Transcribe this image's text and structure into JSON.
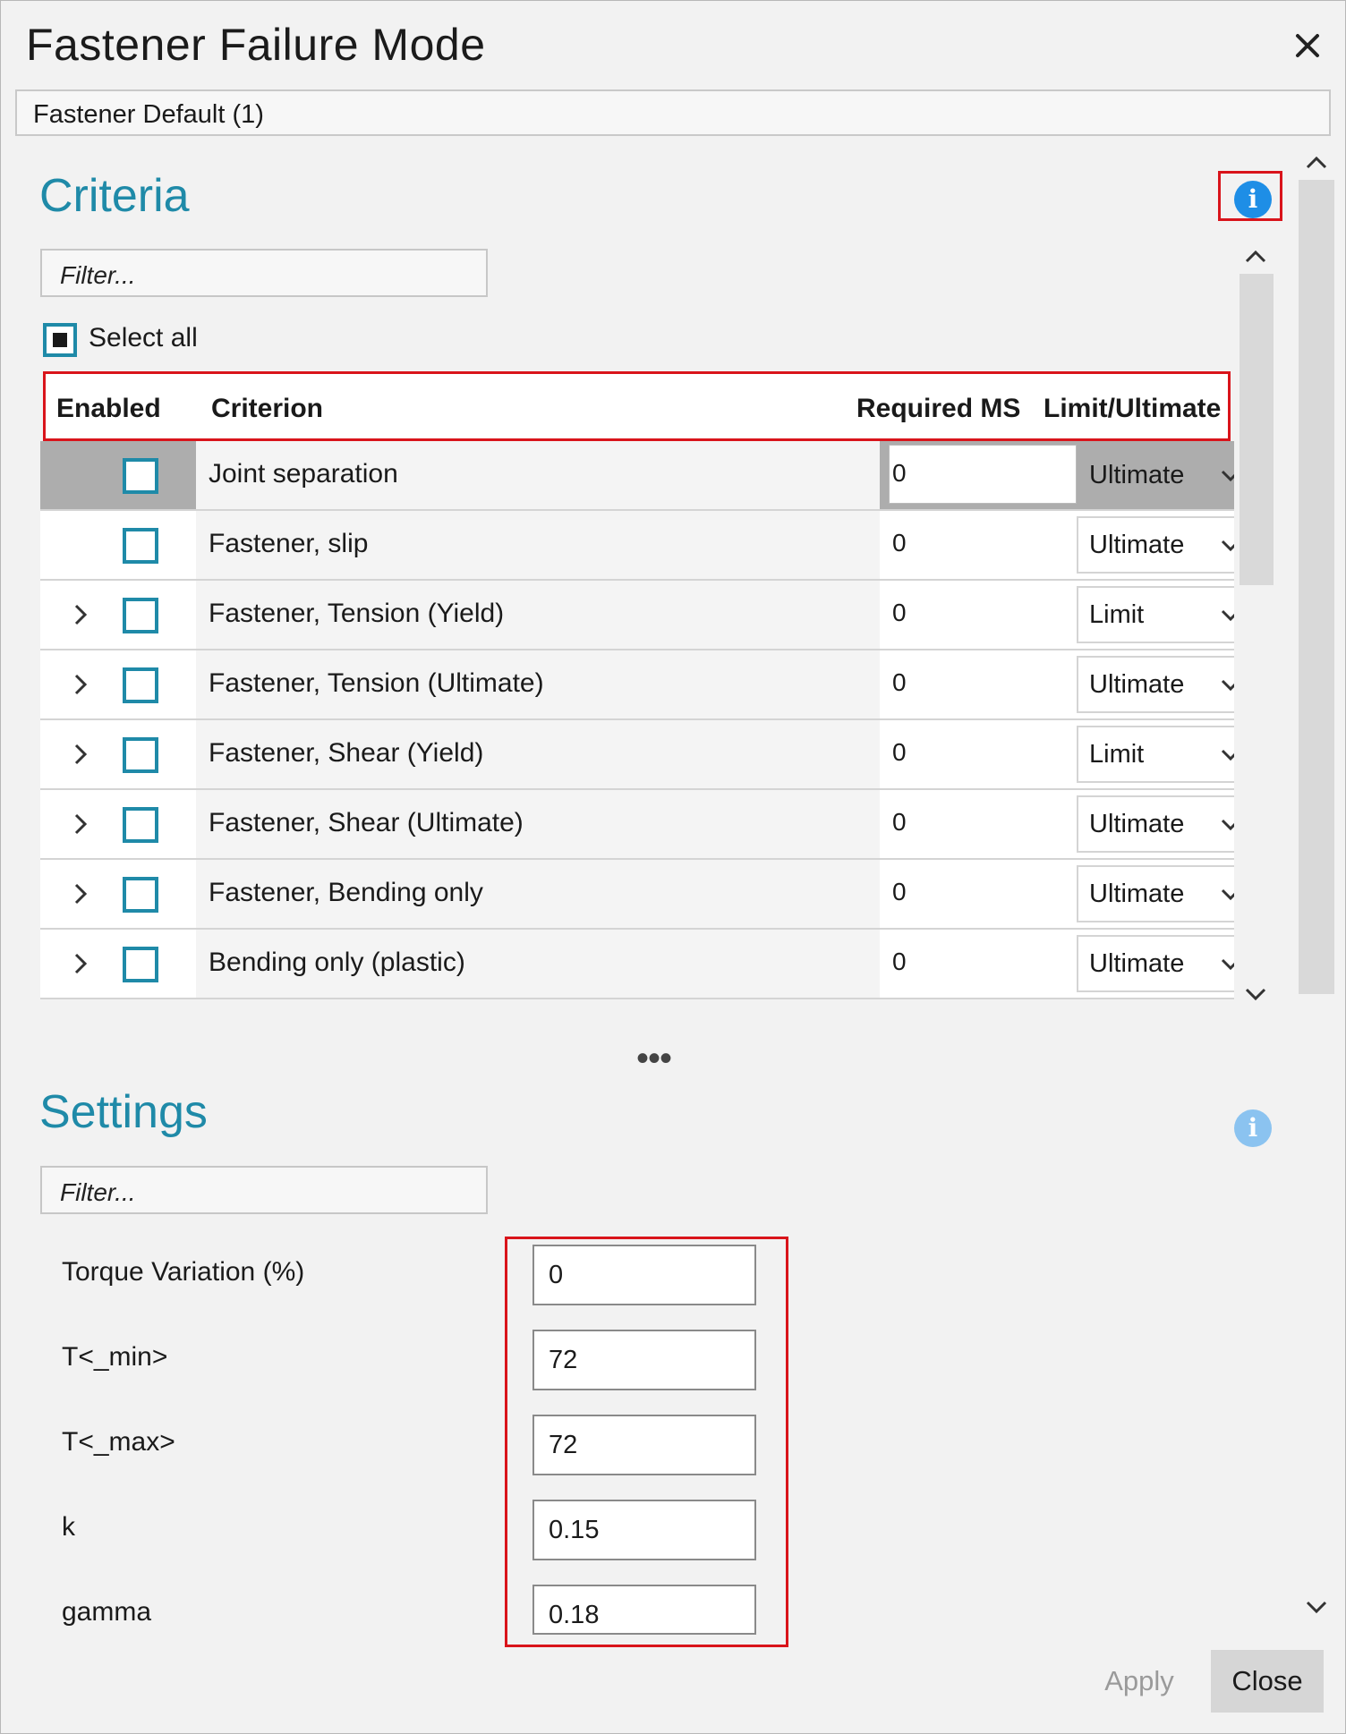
{
  "dialog": {
    "title": "Fastener Failure Mode",
    "profile": "Fastener Default (1)"
  },
  "criteria": {
    "title": "Criteria",
    "filter_placeholder": "Filter...",
    "select_all_label": "Select all",
    "columns": {
      "enabled": "Enabled",
      "criterion": "Criterion",
      "required_ms": "Required MS",
      "limit_ultimate": "Limit/Ultimate"
    },
    "rows": [
      {
        "criterion": "Joint separation",
        "required_ms": "0",
        "limit_ultimate": "Ultimate",
        "expandable": false,
        "enabled": false,
        "selected": true
      },
      {
        "criterion": "Fastener, slip",
        "required_ms": "0",
        "limit_ultimate": "Ultimate",
        "expandable": false,
        "enabled": false
      },
      {
        "criterion": "Fastener, Tension (Yield)",
        "required_ms": "0",
        "limit_ultimate": "Limit",
        "expandable": true,
        "enabled": false
      },
      {
        "criterion": "Fastener, Tension (Ultimate)",
        "required_ms": "0",
        "limit_ultimate": "Ultimate",
        "expandable": true,
        "enabled": false
      },
      {
        "criterion": "Fastener, Shear (Yield)",
        "required_ms": "0",
        "limit_ultimate": "Limit",
        "expandable": true,
        "enabled": false
      },
      {
        "criterion": "Fastener, Shear (Ultimate)",
        "required_ms": "0",
        "limit_ultimate": "Ultimate",
        "expandable": true,
        "enabled": false
      },
      {
        "criterion": "Fastener, Bending only",
        "required_ms": "0",
        "limit_ultimate": "Ultimate",
        "expandable": true,
        "enabled": false
      },
      {
        "criterion": "Bending only (plastic)",
        "required_ms": "0",
        "limit_ultimate": "Ultimate",
        "expandable": true,
        "enabled": false
      }
    ]
  },
  "ellipsis": "•••",
  "settings": {
    "title": "Settings",
    "filter_placeholder": "Filter...",
    "items": [
      {
        "label": "Torque Variation (%)",
        "value": "0"
      },
      {
        "label": "T<_min>",
        "value": "72"
      },
      {
        "label": "T<_max>",
        "value": "72"
      },
      {
        "label": "k",
        "value": "0.15"
      },
      {
        "label": "gamma",
        "value": "0.18"
      }
    ]
  },
  "buttons": {
    "apply": "Apply",
    "close": "Close"
  },
  "icons": {
    "close": "close-icon",
    "info": "info-icon",
    "chevron_up": "chevron-up-icon",
    "chevron_down": "chevron-down-icon",
    "chevron_right": "chevron-right-icon"
  },
  "colors": {
    "accent": "#1f8aa8",
    "info": "#1e8ee6",
    "highlight": "#d9141b"
  }
}
